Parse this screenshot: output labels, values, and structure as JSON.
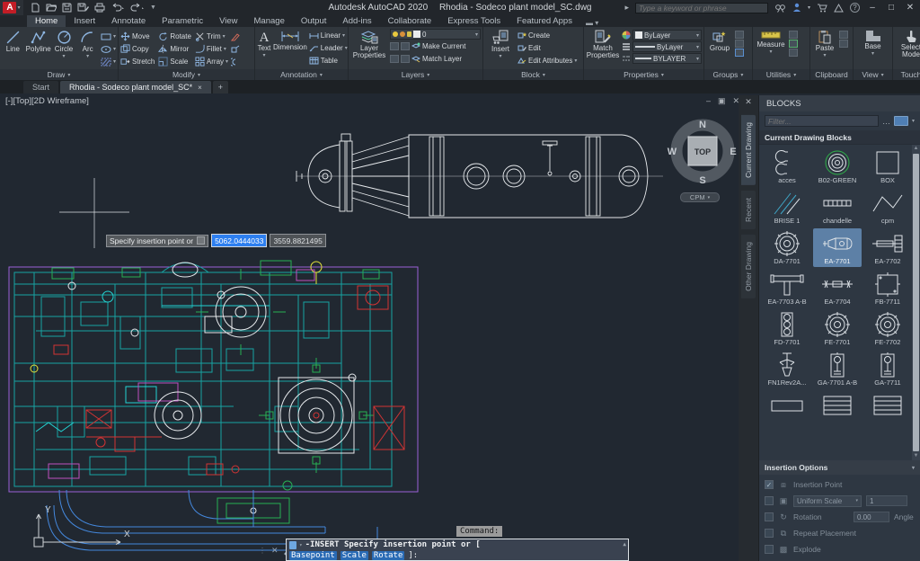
{
  "titlebar": {
    "app_title": "Autodesk AutoCAD 2020",
    "doc_title": "Rhodia - Sodeco plant model_SC.dwg",
    "search_placeholder": "Type a keyword or phrase"
  },
  "ribbon": {
    "tabs": [
      "Home",
      "Insert",
      "Annotate",
      "Parametric",
      "View",
      "Manage",
      "Output",
      "Add-ins",
      "Collaborate",
      "Express Tools",
      "Featured Apps"
    ],
    "active_tab": "Home",
    "draw": {
      "label": "Draw",
      "tools": [
        "Line",
        "Polyline",
        "Circle",
        "Arc"
      ]
    },
    "modify": {
      "label": "Modify",
      "tools": [
        "Move",
        "Rotate",
        "Trim",
        "Copy",
        "Mirror",
        "Fillet",
        "Stretch",
        "Scale",
        "Array"
      ]
    },
    "annotation": {
      "label": "Annotation",
      "tools": [
        "Text",
        "Dimension",
        "Linear",
        "Leader",
        "Table"
      ]
    },
    "layers": {
      "label": "Layers",
      "layer_value": "0",
      "tools": [
        "Layer Properties",
        "Make Current",
        "Match Layer"
      ]
    },
    "block": {
      "label": "Block",
      "tools": [
        "Insert",
        "Create",
        "Edit",
        "Edit Attributes"
      ]
    },
    "properties": {
      "label": "Properties",
      "tools": [
        "Match Properties"
      ],
      "color": "ByLayer",
      "lineweight": "ByLayer",
      "linetype": "BYLAYER"
    },
    "groups": {
      "label": "Groups",
      "tools": [
        "Group"
      ]
    },
    "utilities": {
      "label": "Utilities",
      "tools": [
        "Measure"
      ]
    },
    "clipboard": {
      "label": "Clipboard",
      "tools": [
        "Paste"
      ]
    },
    "view": {
      "label": "View",
      "tools": [
        "Base"
      ]
    },
    "touch": {
      "label": "Touch",
      "tools": [
        "Select Mode"
      ]
    }
  },
  "filetabs": {
    "start": "Start",
    "drawing": "Rhodia - Sodeco plant model_SC*",
    "close": "×",
    "new_tab": "+"
  },
  "viewport": {
    "label": "[-][Top][2D Wireframe]",
    "viewcube": {
      "n": "N",
      "e": "E",
      "s": "S",
      "w": "W",
      "center": "TOP",
      "below": "CPM"
    },
    "ucs": {
      "x": "X",
      "y": "Y"
    },
    "tooltip": {
      "prompt": "Specify insertion point or",
      "x_value": "5062.0444033",
      "y_value": "3559.8821495"
    },
    "command_history": "Command:",
    "command_line1": "-INSERT Specify insertion point or [",
    "command_keywords": [
      "Basepoint",
      "Scale",
      "Rotate"
    ],
    "command_suffix": "]:"
  },
  "blocks_palette": {
    "title": "BLOCKS",
    "filter_placeholder": "Filter...",
    "section": "Current Drawing Blocks",
    "tabs": [
      "Current Drawing",
      "Recent",
      "Other Drawing"
    ],
    "active_tab": "Current Drawing",
    "items": [
      {
        "label": "acces",
        "icon": "arcs"
      },
      {
        "label": "B02-GREEN",
        "icon": "green-rings"
      },
      {
        "label": "BOX",
        "icon": "square"
      },
      {
        "label": "BRISE 1",
        "icon": "diagonal"
      },
      {
        "label": "chandelle",
        "icon": "bar"
      },
      {
        "label": "cpm",
        "icon": "line"
      },
      {
        "label": "DA-7701",
        "icon": "flange"
      },
      {
        "label": "EA-7701",
        "icon": "vessel",
        "selected": true
      },
      {
        "label": "EA-7702",
        "icon": "exchanger"
      },
      {
        "label": "EA-7703 A-B",
        "icon": "tee"
      },
      {
        "label": "EA-7704",
        "icon": "shaft"
      },
      {
        "label": "FB-7711",
        "icon": "square-ticks"
      },
      {
        "label": "FD-7701",
        "icon": "column"
      },
      {
        "label": "FE-7701",
        "icon": "flange"
      },
      {
        "label": "FE-7702",
        "icon": "flange"
      },
      {
        "label": "FN1Rev2A...",
        "icon": "agitator"
      },
      {
        "label": "GA-7701 A-B",
        "icon": "pump"
      },
      {
        "label": "GA-7711",
        "icon": "pump"
      },
      {
        "label": "",
        "icon": "rect"
      },
      {
        "label": "",
        "icon": "rect3"
      },
      {
        "label": "",
        "icon": "rect3"
      }
    ],
    "insertion_options": {
      "title": "Insertion Options",
      "insertion_point": "Insertion Point",
      "uniform_scale": "Uniform Scale",
      "scale_value": "1",
      "rotation": "Rotation",
      "rotation_value": "0.00",
      "angle_label": "Angle",
      "repeat_placement": "Repeat Placement",
      "explode": "Explode"
    }
  },
  "colors": {
    "accent": "#6ea7e0",
    "selection": "#5d80a6",
    "dynamic_input": "#2d7ff0",
    "canvas_bg": "#212831"
  }
}
